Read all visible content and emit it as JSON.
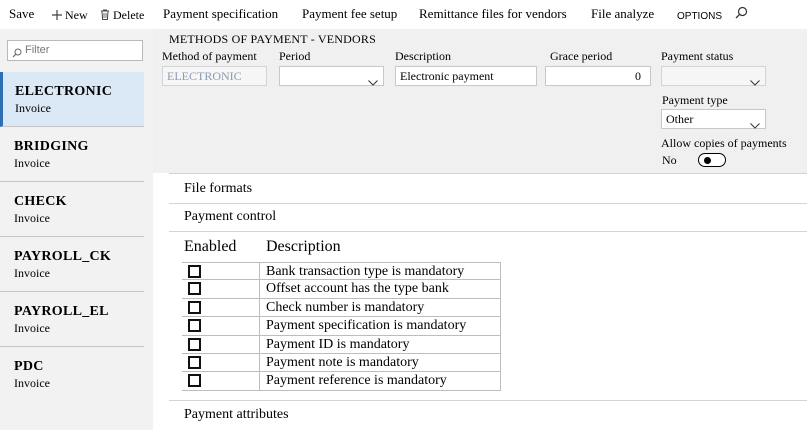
{
  "toolbar": {
    "save": "Save",
    "new": "New",
    "delete": "Delete",
    "payment_specification": "Payment specification",
    "payment_fee_setup": "Payment fee setup",
    "remittance_files": "Remittance files for vendors",
    "file_analyze": "File analyze",
    "options": "OPTIONS"
  },
  "filter": {
    "placeholder": "Filter"
  },
  "methods": [
    {
      "name": "ELECTRONIC",
      "type": "Invoice",
      "selected": true
    },
    {
      "name": "BRIDGING",
      "type": "Invoice"
    },
    {
      "name": "CHECK",
      "type": "Invoice"
    },
    {
      "name": "PAYROLL_CK",
      "type": "Invoice"
    },
    {
      "name": "PAYROLL_EL",
      "type": "Invoice"
    },
    {
      "name": "PDC",
      "type": "Invoice"
    }
  ],
  "header": {
    "title": "METHODS OF PAYMENT - VENDORS",
    "method_label": "Method of payment",
    "method_value": "ELECTRONIC",
    "period_label": "Period",
    "period_value": "",
    "description_label": "Description",
    "description_value": "Electronic payment",
    "grace_label": "Grace period",
    "grace_value": "0",
    "status_label": "Payment status",
    "status_value": "",
    "type_label": "Payment type",
    "type_value": "Other",
    "copies_label": "Allow copies of payments",
    "copies_value": "No"
  },
  "sections": {
    "file_formats": "File formats",
    "payment_control": "Payment control",
    "payment_attributes": "Payment attributes"
  },
  "grid": {
    "col_enabled": "Enabled",
    "col_description": "Description",
    "rows": [
      {
        "description": "Bank transaction type is mandatory",
        "enabled": false
      },
      {
        "description": "Offset account has the type bank",
        "enabled": false
      },
      {
        "description": "Check number is mandatory",
        "enabled": false
      },
      {
        "description": "Payment specification is mandatory",
        "enabled": false
      },
      {
        "description": "Payment ID is mandatory",
        "enabled": false
      },
      {
        "description": "Payment note is mandatory",
        "enabled": false
      },
      {
        "description": "Payment reference is mandatory",
        "enabled": false
      }
    ]
  },
  "colors": {
    "accent": "#2f6fb6",
    "selected_bg": "#dbe8f6",
    "disabled_text": "#8a9bb0"
  },
  "icons": [
    "plus-icon",
    "trash-icon",
    "search-icon",
    "chevron-down-icon",
    "checkbox-icon"
  ]
}
